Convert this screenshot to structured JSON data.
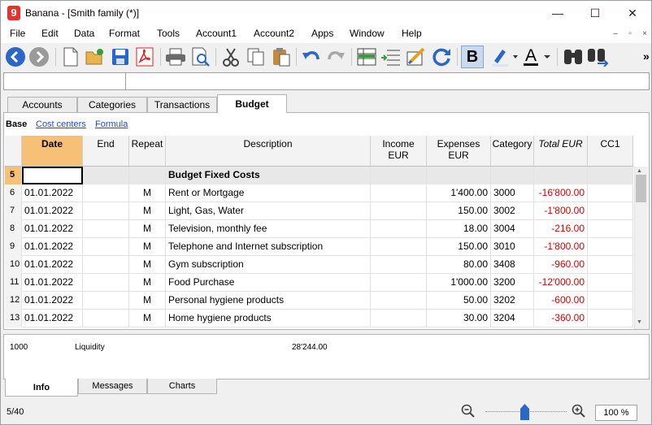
{
  "window": {
    "title": "Banana - [Smith family (*)]",
    "logo": "9",
    "minimize": "—",
    "maximize": "☐",
    "close": "✕"
  },
  "menu": [
    "File",
    "Edit",
    "Data",
    "Format",
    "Tools",
    "Account1",
    "Account2",
    "Apps",
    "Window",
    "Help"
  ],
  "mdi": [
    "–",
    "▫",
    "×"
  ],
  "toolbar": {
    "bold_label": "B",
    "font_color_label": "A",
    "overflow": "»"
  },
  "tabs": [
    "Accounts",
    "Categories",
    "Transactions",
    "Budget"
  ],
  "active_tab": "Budget",
  "views": {
    "active": "Base",
    "links": [
      "Cost centers",
      "Formula"
    ]
  },
  "table": {
    "columns": [
      "Date",
      "End",
      "Repeat",
      "Description",
      "Income EUR",
      "Expenses EUR",
      "Category",
      "Total EUR",
      "CC1"
    ],
    "header_row": {
      "num": "5",
      "description": "Budget Fixed Costs"
    },
    "rows": [
      {
        "num": "6",
        "date": "01.01.2022",
        "repeat": "M",
        "description": "Rent or Mortgage",
        "income": "",
        "expenses": "1'400.00",
        "category": "3000",
        "total": "-16'800.00"
      },
      {
        "num": "7",
        "date": "01.01.2022",
        "repeat": "M",
        "description": "Light, Gas, Water",
        "income": "",
        "expenses": "150.00",
        "category": "3002",
        "total": "-1'800.00"
      },
      {
        "num": "8",
        "date": "01.01.2022",
        "repeat": "M",
        "description": "Television, monthly fee",
        "income": "",
        "expenses": "18.00",
        "category": "3004",
        "total": "-216.00"
      },
      {
        "num": "9",
        "date": "01.01.2022",
        "repeat": "M",
        "description": "Telephone and Internet subscription",
        "income": "",
        "expenses": "150.00",
        "category": "3010",
        "total": "-1'800.00"
      },
      {
        "num": "10",
        "date": "01.01.2022",
        "repeat": "M",
        "description": "Gym subscription",
        "income": "",
        "expenses": "80.00",
        "category": "3408",
        "total": "-960.00"
      },
      {
        "num": "11",
        "date": "01.01.2022",
        "repeat": "M",
        "description": "Food Purchase",
        "income": "",
        "expenses": "1'000.00",
        "category": "3200",
        "total": "-12'000.00"
      },
      {
        "num": "12",
        "date": "01.01.2022",
        "repeat": "M",
        "description": "Personal hygiene products",
        "income": "",
        "expenses": "50.00",
        "category": "3202",
        "total": "-600.00"
      },
      {
        "num": "13",
        "date": "01.01.2022",
        "repeat": "M",
        "description": "Home hygiene products",
        "income": "",
        "expenses": "30.00",
        "category": "3204",
        "total": "-360.00"
      }
    ]
  },
  "info": {
    "account": "1000",
    "description": "Liquidity",
    "amount": "28'244.00"
  },
  "bottom_tabs": [
    "Info",
    "Messages",
    "Charts"
  ],
  "status": {
    "position": "5/40",
    "zoom": "100 %",
    "zoom_fraction": 0.45
  },
  "colors": {
    "selected_header": "#f6c176",
    "negative": "#d40000",
    "link": "#1a4fd0"
  }
}
